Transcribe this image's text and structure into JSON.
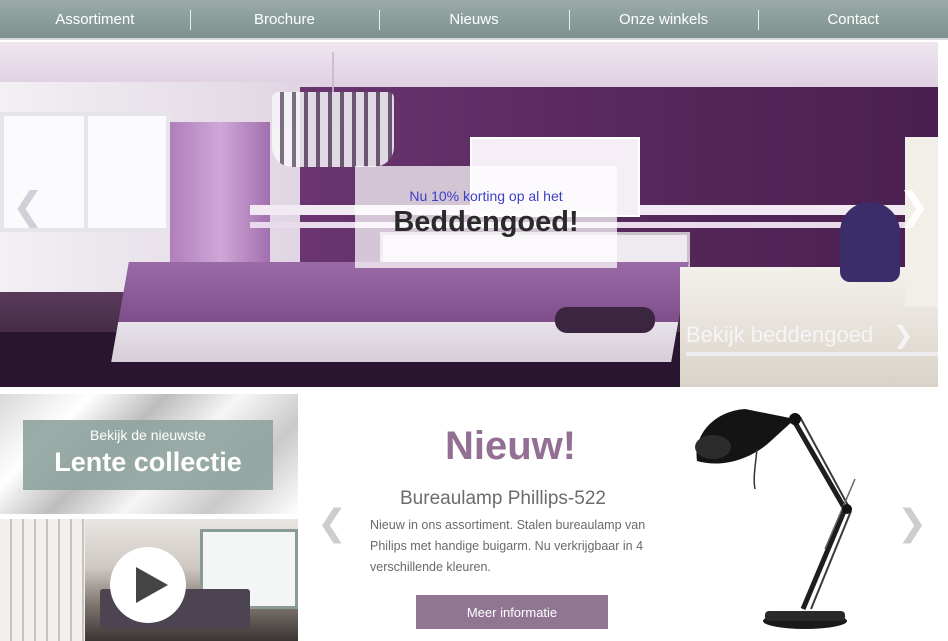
{
  "nav": {
    "items": [
      {
        "label": "Assortiment"
      },
      {
        "label": "Brochure"
      },
      {
        "label": "Nieuws"
      },
      {
        "label": "Onze winkels"
      },
      {
        "label": "Contact"
      }
    ]
  },
  "hero": {
    "promo_small": "Nu 10% korting op al het",
    "promo_big": "Beddengoed!",
    "cta_label": "Bekijk beddengoed",
    "prev_icon": "chevron-left-icon",
    "next_icon": "chevron-right-icon"
  },
  "tiles": {
    "collection_small": "Bekijk de nieuwste",
    "collection_big": "Lente collectie",
    "video_icon": "play-icon"
  },
  "product": {
    "heading": "Nieuw!",
    "name": "Bureaulamp Phillips-522",
    "description": "Nieuw in ons assortiment. Stalen bureaulamp van Philips met handige buigarm. Nu verkrijgbaar in 4 verschillende kleuren.",
    "button_label": "Meer informatie"
  },
  "colors": {
    "nav_bg": "#8a9d9a",
    "accent_purple": "#946f94",
    "button_purple": "#917693",
    "promo_blue": "#3a3fc8"
  }
}
